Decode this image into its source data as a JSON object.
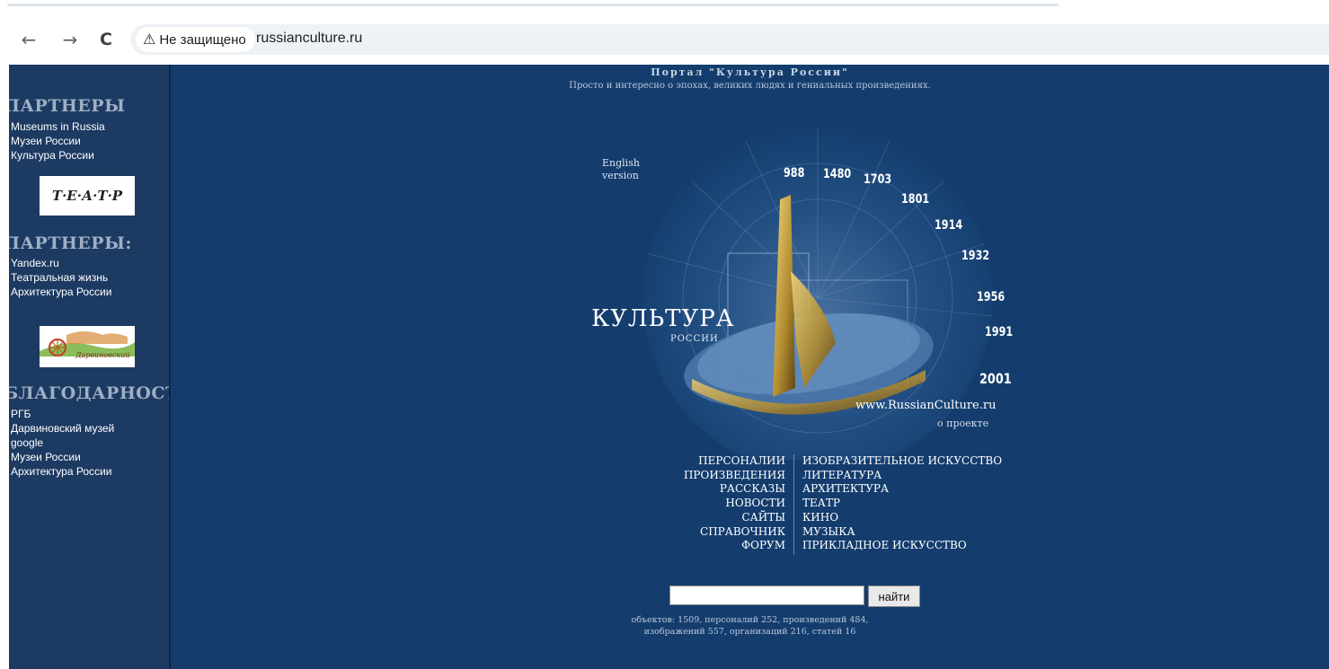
{
  "browser": {
    "nav": {
      "back_label": "←",
      "forward_label": "→",
      "reload_label": "C"
    },
    "security_icon": "warning-triangle-icon",
    "security_glyph": "⚠",
    "security_label": "Не защищено",
    "url": "russianculture.ru"
  },
  "sidebar": {
    "section1_title": "ПАРТНЕРЫ",
    "section1_links": [
      "Museums in Russia",
      "Музеи России",
      "Культура России"
    ],
    "banner1_text": "Т·Е·А·Т·Р",
    "section2_title": "ПАРТНЕРЫ:",
    "section2_links": [
      "Yandex.ru",
      "Театральная жизнь",
      "Архитектура России"
    ],
    "banner2_text": "Дарвиновский",
    "section3_title": "БЛАГОДАРНОСТИ:",
    "section3_links": [
      "РГБ",
      "Дарвиновский музей",
      "google",
      "Музеи России",
      "Архитектура России"
    ]
  },
  "header": {
    "title": "Портал \"Культура России\"",
    "subtitle": "Просто и интересно о эпохах, великих людях и гениальных произведениях."
  },
  "english": {
    "line1": "English",
    "line2": "version"
  },
  "dial": {
    "years": [
      "988",
      "1480",
      "1703",
      "1801",
      "1914",
      "1932",
      "1956",
      "1991",
      "2001"
    ]
  },
  "logo": {
    "main": "КУЛЬТУРА",
    "sub": "РОССИИ"
  },
  "site_url": "www.RussianCulture.ru",
  "about_label": "о проекте",
  "menu": {
    "left": [
      "ПЕРСОНАЛИИ",
      "ПРОИЗВЕДЕНИЯ",
      "РАССКАЗЫ",
      "НОВОСТИ",
      "САЙТЫ",
      "СПРАВОЧНИК",
      "ФОРУМ"
    ],
    "right": [
      "ИЗОБРАЗИТЕЛЬНОЕ ИСКУССТВО",
      "ЛИТЕРАТУРА",
      "АРХИТЕКТУРА",
      "ТЕАТР",
      "КИНО",
      "МУЗЫКА",
      "ПРИКЛАДНОЕ ИСКУССТВО"
    ]
  },
  "search": {
    "value": "",
    "button_label": "найти"
  },
  "stats": {
    "line1": "объектов: 1509, персоналий 252, произведений 484,",
    "line2": "изображений 557, организаций 216, статей 16"
  }
}
